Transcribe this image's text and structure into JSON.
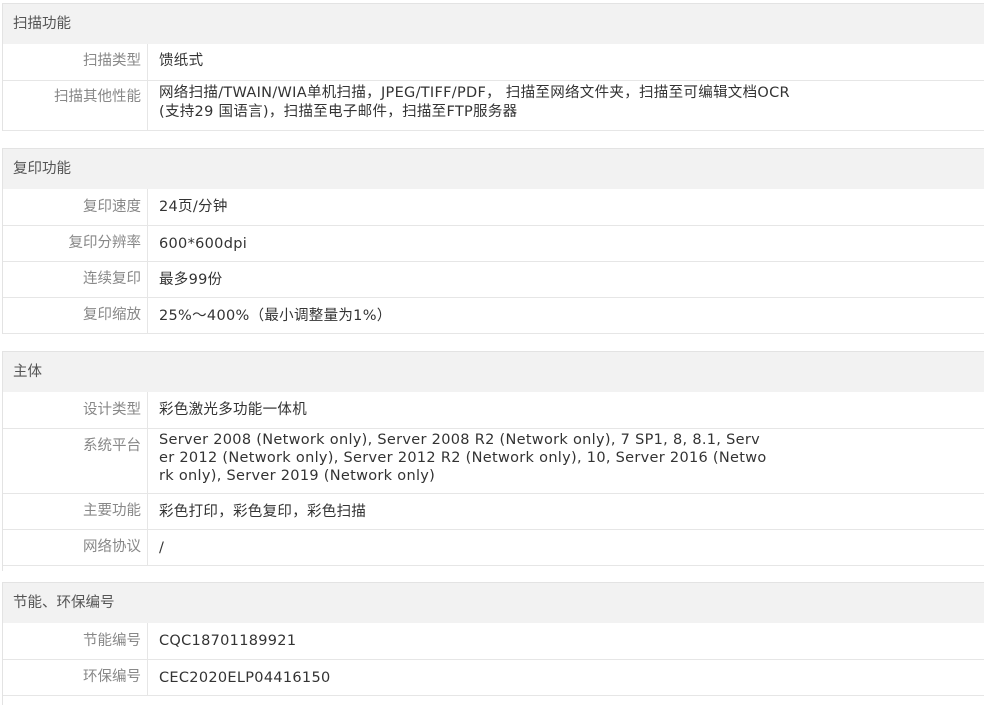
{
  "sections": [
    {
      "title": "扫描功能",
      "rows": [
        {
          "label": "扫描类型",
          "value": "馈纸式"
        },
        {
          "label": "扫描其他性能",
          "value": "网络扫描/TWAIN/WIA单机扫描，JPEG/TIFF/PDF， 扫描至网络文件夹，扫描至可编辑文档OCR(支持29 国语言)，扫描至电子邮件，扫描至FTP服务器"
        }
      ]
    },
    {
      "title": "复印功能",
      "rows": [
        {
          "label": "复印速度",
          "value": "24页/分钟"
        },
        {
          "label": "复印分辨率",
          "value": "600*600dpi"
        },
        {
          "label": "连续复印",
          "value": "最多99份"
        },
        {
          "label": "复印缩放",
          "value": "25%～400%（最小调整量为1%）"
        }
      ]
    },
    {
      "title": "主体",
      "rows": [
        {
          "label": "设计类型",
          "value": "彩色激光多功能一体机"
        },
        {
          "label": "系统平台",
          "value": "Server 2008 (Network only), Server 2008 R2 (Network only), 7 SP1, 8, 8.1, Server 2012 (Network only), Server 2012 R2 (Network only), 10, Server 2016 (Network only), Server 2019 (Network only)"
        },
        {
          "label": "主要功能",
          "value": "彩色打印，彩色复印，彩色扫描"
        },
        {
          "label": "网络协议",
          "value": "/"
        }
      ]
    },
    {
      "title": "节能、环保编号",
      "rows": [
        {
          "label": "节能编号",
          "value": "CQC18701189921"
        },
        {
          "label": "环保编号",
          "value": "CEC2020ELP04416150"
        }
      ]
    }
  ]
}
